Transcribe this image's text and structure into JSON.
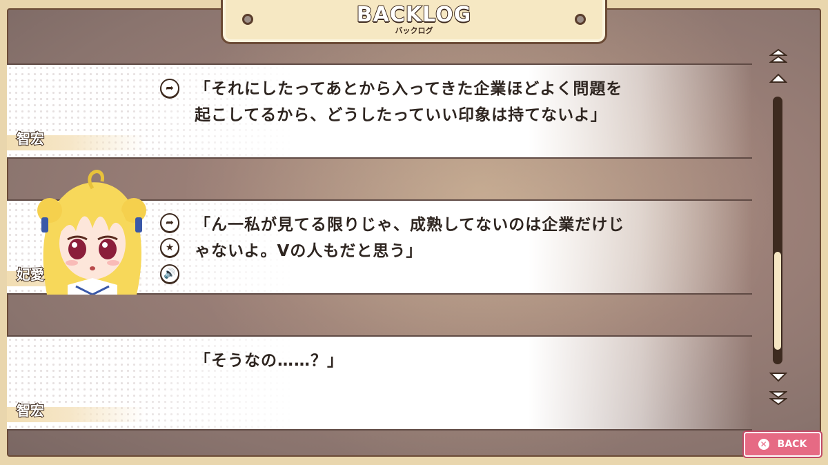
{
  "header": {
    "title": "BACKLOG",
    "subtitle": "バックログ"
  },
  "entries": [
    {
      "speaker": "智宏",
      "text": "「それにしたってあとから入ってきた企業ほどよく問題を\n起こしてるから、どうしたっていい印象は持てないよ」",
      "has_avatar": false,
      "icons": [
        "jump-icon"
      ]
    },
    {
      "speaker": "妃愛",
      "text": "「ん一私が見てる限りじゃ、成熟してないのは企業だけじ\nゃないよ。Vの人もだと思う」",
      "has_avatar": true,
      "icons": [
        "jump-icon",
        "star-icon",
        "voice-icon"
      ]
    },
    {
      "speaker": "智宏",
      "text": "「そうなの……？」",
      "has_avatar": false,
      "icons": []
    }
  ],
  "scrollbar": {
    "top_button": "scroll-to-top-icon",
    "up_button": "scroll-up-icon",
    "down_button": "scroll-down-icon",
    "bottom_button": "scroll-to-bottom-icon",
    "position": 0.92
  },
  "back_button": {
    "label": "BACK",
    "icon": "close-icon"
  },
  "colors": {
    "frame": "#e9d6ad",
    "outline": "#3d2a1f",
    "back_button": "#e66a84",
    "scroll_thumb": "#f6e6c3"
  }
}
